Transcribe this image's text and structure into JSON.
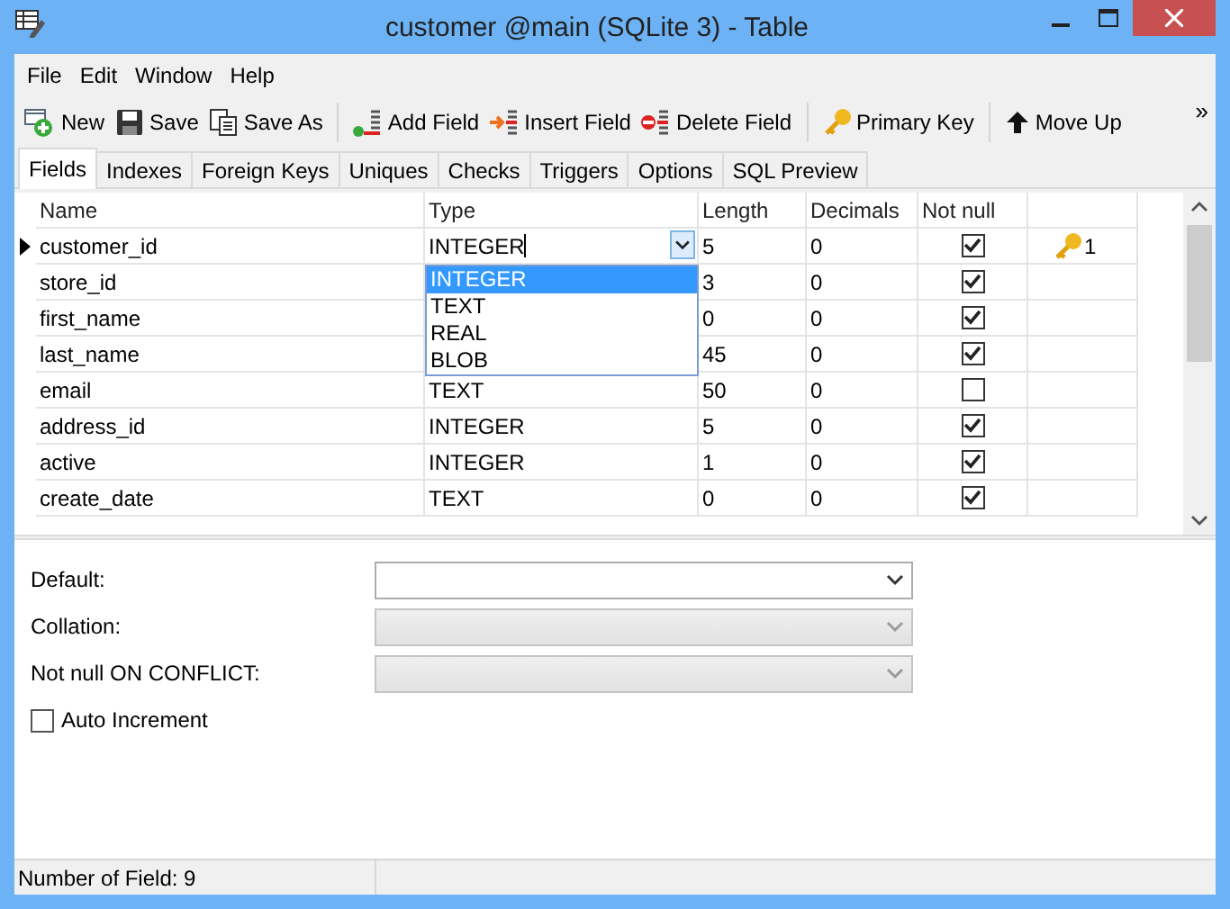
{
  "window": {
    "title": "customer @main (SQLite 3) - Table"
  },
  "menu": [
    "File",
    "Edit",
    "Window",
    "Help"
  ],
  "toolbar": [
    {
      "items": [
        "New",
        "Save",
        "Save As"
      ]
    },
    {
      "items": [
        "Add Field",
        "Insert Field",
        "Delete Field"
      ]
    },
    {
      "items": [
        "Primary Key"
      ]
    },
    {
      "items": [
        "Move Up"
      ]
    }
  ],
  "toolbar_overflow": "»",
  "tabs": [
    {
      "label": "Fields",
      "selected": true
    },
    {
      "label": "Indexes",
      "selected": false
    },
    {
      "label": "Foreign Keys",
      "selected": false
    },
    {
      "label": "Uniques",
      "selected": false
    },
    {
      "label": "Checks",
      "selected": false
    },
    {
      "label": "Triggers",
      "selected": false
    },
    {
      "label": "Options",
      "selected": false
    },
    {
      "label": "SQL Preview",
      "selected": false
    }
  ],
  "grid": {
    "columns": [
      "Name",
      "Type",
      "Length",
      "Decimals",
      "Not null"
    ],
    "rows": [
      {
        "name": "customer_id",
        "type": "INTEGER",
        "length": "5",
        "decimals": "0",
        "not_null": true,
        "current": true,
        "key_order": "1"
      },
      {
        "name": "store_id",
        "length": "3",
        "decimals": "0",
        "not_null": true,
        "current": false
      },
      {
        "name": "first_name",
        "length": "0",
        "decimals": "0",
        "not_null": true,
        "current": false
      },
      {
        "name": "last_name",
        "length": "45",
        "decimals": "0",
        "not_null": true,
        "current": false
      },
      {
        "name": "email",
        "type": "TEXT",
        "length": "50",
        "decimals": "0",
        "not_null": false,
        "current": false
      },
      {
        "name": "address_id",
        "type": "INTEGER",
        "length": "5",
        "decimals": "0",
        "not_null": true,
        "current": false
      },
      {
        "name": "active",
        "type": "INTEGER",
        "length": "1",
        "decimals": "0",
        "not_null": true,
        "current": false
      },
      {
        "name": "create_date",
        "type": "TEXT",
        "length": "0",
        "decimals": "0",
        "not_null": true,
        "current": false
      }
    ],
    "type_dropdown": [
      {
        "label": "INTEGER",
        "selected": true
      },
      {
        "label": "TEXT",
        "selected": false
      },
      {
        "label": "REAL",
        "selected": false
      },
      {
        "label": "BLOB",
        "selected": false
      }
    ]
  },
  "properties": [
    {
      "label": "Default:",
      "disabled": false
    },
    {
      "label": "Collation:",
      "disabled": true
    },
    {
      "label": "Not null ON CONFLICT:",
      "disabled": true
    }
  ],
  "auto_increment": {
    "label": "Auto Increment",
    "checked": false
  },
  "status_bar": "Number of Field: 9"
}
